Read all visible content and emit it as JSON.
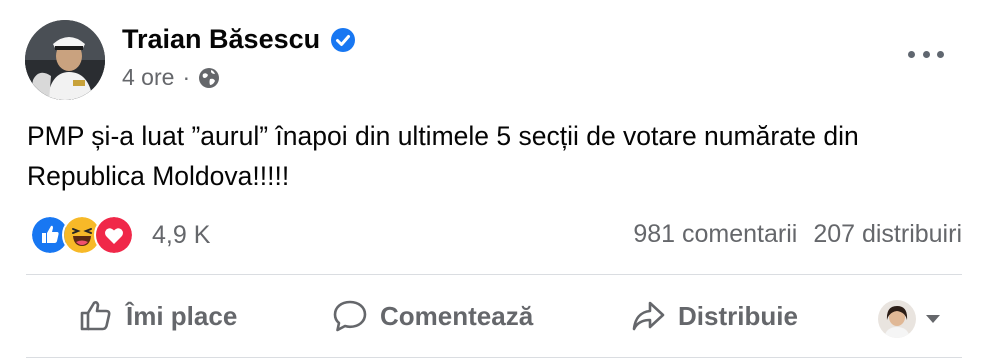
{
  "post": {
    "author": "Traian Băsescu",
    "time": "4 ore",
    "separator": "·",
    "text": "PMP și-a luat ”aurul” înapoi din ultimele 5 secții de votare numărate din Republica Moldova!!!!!"
  },
  "reactions": {
    "count": "4,9 K",
    "types": [
      "like",
      "haha",
      "love"
    ]
  },
  "stats": {
    "comments": "981 comentarii",
    "shares": "207 distribuiri"
  },
  "actions": {
    "like": "Îmi place",
    "comment": "Comentează",
    "share": "Distribuie"
  },
  "colors": {
    "verified": "#1877f2",
    "like": "#1877f2",
    "love": "#f02849",
    "haha": "#f7b928",
    "muted": "#65676b"
  }
}
